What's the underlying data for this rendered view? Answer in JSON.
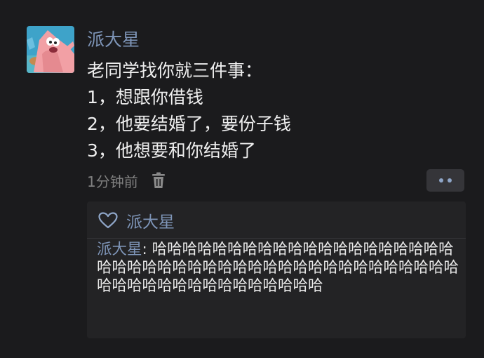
{
  "post": {
    "author": "派大星",
    "lines": [
      "老同学找你就三件事：",
      "1，想跟你借钱",
      "2，他要结婚了，要份子钱",
      "3，他想要和你结婚了"
    ],
    "timestamp": "1分钟前"
  },
  "likes": {
    "names": "派大星"
  },
  "comment": {
    "author": "派大星",
    "separator": ": ",
    "text": "哈哈哈哈哈哈哈哈哈哈哈哈哈哈哈哈哈哈哈哈哈哈哈哈哈哈哈哈哈哈哈哈哈哈哈哈哈哈哈哈哈哈哈哈哈哈哈哈哈哈哈哈哈哈哈哈哈哈哈"
  },
  "icons": {
    "avatar": "patrick-star-avatar",
    "delete": "trash-icon",
    "more": "more-dots-icon",
    "like": "heart-icon"
  },
  "colors": {
    "background": "#1b1b1d",
    "name_link": "#7e95b8",
    "text": "#eeeeee",
    "muted": "#808080",
    "panel": "#232325"
  }
}
